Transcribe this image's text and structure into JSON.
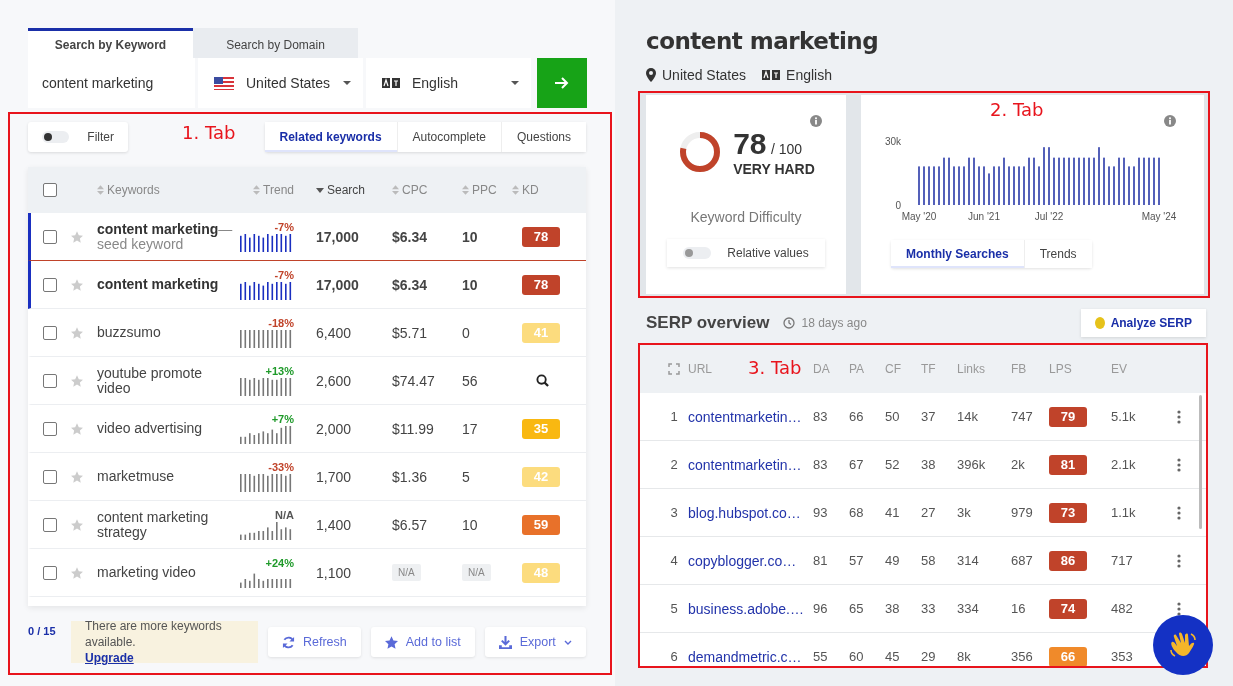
{
  "search_tabs": [
    {
      "label": "Search by Keyword",
      "selected": true
    },
    {
      "label": "Search by Domain",
      "selected": false
    }
  ],
  "search": {
    "value": "content marketing",
    "country": "United States",
    "language": "English"
  },
  "keywords_panel": {
    "annotation": "1. Tab",
    "filter": {
      "label": "Filter",
      "on": false
    },
    "tabs": [
      {
        "label": "Related keywords",
        "selected": true
      },
      {
        "label": "Autocomplete",
        "selected": false
      },
      {
        "label": "Questions",
        "selected": false
      }
    ],
    "select_all": {
      "checked": false
    },
    "columns": [
      {
        "label": "Keywords",
        "sorted": false
      },
      {
        "label": "Trend",
        "sorted": false
      },
      {
        "label": "Search",
        "sorted": true
      },
      {
        "label": "CPC",
        "sorted": false
      },
      {
        "label": "PPC",
        "sorted": false
      },
      {
        "label": "KD",
        "sorted": false
      }
    ],
    "rows": [
      {
        "keyword": "content marketing",
        "note": "— seed keyword",
        "highlighted": true,
        "checked": false,
        "starred": false,
        "trend": {
          "text": "-7%",
          "color": "#c0432a"
        },
        "search": "17,000",
        "cpc": "$6.34",
        "ppc": "10",
        "missing_costs": false,
        "kd": {
          "text": "78",
          "color": "#c0432a"
        }
      },
      {
        "keyword": "content marketing",
        "highlighted": true,
        "checked": false,
        "starred": false,
        "trend": {
          "text": "-7%",
          "color": "#c0432a"
        },
        "search": "17,000",
        "cpc": "$6.34",
        "ppc": "10",
        "missing_costs": false,
        "kd": {
          "text": "78",
          "color": "#c0432a"
        }
      },
      {
        "keyword": "buzzsumo",
        "highlighted": false,
        "checked": false,
        "starred": false,
        "trend": {
          "text": "-18%",
          "color": "#c0432a"
        },
        "search": "6,400",
        "cpc": "$5.71",
        "ppc": "0",
        "missing_costs": false,
        "kd": {
          "text": "41",
          "color": "#fcdc7e"
        }
      },
      {
        "keyword": "youtube promote video",
        "highlighted": false,
        "checked": false,
        "starred": false,
        "trend": {
          "text": "+13%",
          "color": "#1f9a2a"
        },
        "search": "2,600",
        "cpc": "$74.47",
        "ppc": "56",
        "missing_costs": false
      },
      {
        "keyword": "video advertising",
        "highlighted": false,
        "checked": false,
        "starred": false,
        "trend": {
          "text": "+7%",
          "color": "#1f9a2a"
        },
        "search": "2,000",
        "cpc": "$11.99",
        "ppc": "17",
        "missing_costs": false,
        "kd": {
          "text": "35",
          "color": "#f9b811"
        }
      },
      {
        "keyword": "marketmuse",
        "highlighted": false,
        "checked": false,
        "starred": false,
        "trend": {
          "text": "-33%",
          "color": "#c0432a"
        },
        "search": "1,700",
        "cpc": "$1.36",
        "ppc": "5",
        "missing_costs": false,
        "kd": {
          "text": "42",
          "color": "#fcdc7e"
        }
      },
      {
        "keyword": "content marketing strategy",
        "highlighted": false,
        "checked": false,
        "starred": false,
        "trend": {
          "text": "N/A",
          "color": "#555555"
        },
        "search": "1,400",
        "cpc": "$6.57",
        "ppc": "10",
        "missing_costs": false,
        "kd": {
          "text": "59",
          "color": "#e8712a"
        }
      },
      {
        "keyword": "marketing video",
        "highlighted": false,
        "checked": false,
        "starred": false,
        "trend": {
          "text": "+24%",
          "color": "#1f9a2a"
        },
        "search": "1,100",
        "cpc": "N/A",
        "ppc": "N/A",
        "missing_costs": true,
        "kd": {
          "text": "48",
          "color": "#fcdc7e"
        }
      }
    ],
    "counter": "0 / 15",
    "notice": "There are more keywords available.",
    "notice_link": "Upgrade",
    "actions": [
      {
        "label": "Refresh",
        "kind": "refresh",
        "menu": false
      },
      {
        "label": "Add to list",
        "kind": "star",
        "menu": false
      },
      {
        "label": "Export",
        "kind": "download",
        "menu": true
      }
    ]
  },
  "overview": {
    "title": "content marketing",
    "location": "United States",
    "language": "English",
    "annotation": "2. Tab",
    "difficulty": {
      "score": "78",
      "max": "/ 100",
      "level": 0.78,
      "rating": "VERY HARD",
      "label": "Keyword Difficulty",
      "toggle": {
        "label": "Relative values",
        "on": false
      }
    },
    "chart_data": {
      "type": "bar",
      "ylim": [
        0,
        30000
      ],
      "yticks": [
        {
          "value": 0,
          "label": "0"
        },
        {
          "value": 30000,
          "label": "30k"
        }
      ],
      "categories": [
        "May '20",
        null,
        null,
        null,
        null,
        null,
        null,
        null,
        null,
        null,
        null,
        null,
        null,
        "Jun '21",
        null,
        null,
        null,
        null,
        null,
        null,
        null,
        null,
        null,
        null,
        null,
        null,
        "Jul '22",
        null,
        null,
        null,
        null,
        null,
        null,
        null,
        null,
        null,
        null,
        null,
        null,
        null,
        null,
        null,
        null,
        null,
        null,
        null,
        null,
        null,
        "May '24"
      ],
      "series": [
        {
          "color": "#2b3aa8",
          "values": [
            18100,
            18100,
            18100,
            18100,
            18100,
            22200,
            22200,
            18100,
            18100,
            18100,
            22200,
            22200,
            18100,
            18100,
            14800,
            18100,
            18100,
            22200,
            18100,
            18100,
            18100,
            18100,
            22200,
            22200,
            18100,
            27100,
            27100,
            22200,
            22200,
            22200,
            22200,
            22200,
            22200,
            22200,
            22200,
            22200,
            27100,
            22200,
            18100,
            18100,
            22200,
            22200,
            18100,
            18100,
            22200,
            22200,
            22200,
            22200,
            22200
          ]
        }
      ]
    },
    "chart_tabs": [
      {
        "label": "Monthly Searches",
        "selected": true
      },
      {
        "label": "Trends",
        "selected": false
      }
    ]
  },
  "serp": {
    "title": "SERP overview",
    "updated": "18 days ago",
    "button": "Analyze SERP",
    "annotation": "3. Tab",
    "columns": [
      "URL",
      "DA",
      "PA",
      "CF",
      "TF",
      "Links",
      "FB",
      "LPS",
      "EV"
    ],
    "rows": [
      {
        "rank": "1",
        "url": "contentmarketin…",
        "da": "83",
        "pa": "66",
        "cf": "50",
        "tf": "37",
        "links": "14k",
        "fb": "747",
        "lps": {
          "text": "79",
          "color": "#c0432a"
        },
        "ev": "5.1k"
      },
      {
        "rank": "2",
        "url": "contentmarketin…",
        "da": "83",
        "pa": "67",
        "cf": "52",
        "tf": "38",
        "links": "396k",
        "fb": "2k",
        "lps": {
          "text": "81",
          "color": "#c0432a"
        },
        "ev": "2.1k"
      },
      {
        "rank": "3",
        "url": "blog.hubspot.co…",
        "da": "93",
        "pa": "68",
        "cf": "41",
        "tf": "27",
        "links": "3k",
        "fb": "979",
        "lps": {
          "text": "73",
          "color": "#c0432a"
        },
        "ev": "1.1k"
      },
      {
        "rank": "4",
        "url": "copyblogger.co…",
        "da": "81",
        "pa": "57",
        "cf": "49",
        "tf": "58",
        "links": "314",
        "fb": "687",
        "lps": {
          "text": "86",
          "color": "#c0432a"
        },
        "ev": "717"
      },
      {
        "rank": "5",
        "url": "business.adobe.…",
        "da": "96",
        "pa": "65",
        "cf": "38",
        "tf": "33",
        "links": "334",
        "fb": "16",
        "lps": {
          "text": "74",
          "color": "#c0432a"
        },
        "ev": "482"
      },
      {
        "rank": "6",
        "url": "demandmetric.c…",
        "da": "55",
        "pa": "60",
        "cf": "45",
        "tf": "29",
        "links": "8k",
        "fb": "356",
        "lps": {
          "text": "66",
          "color": "#f08a2a"
        },
        "ev": "353"
      }
    ]
  }
}
